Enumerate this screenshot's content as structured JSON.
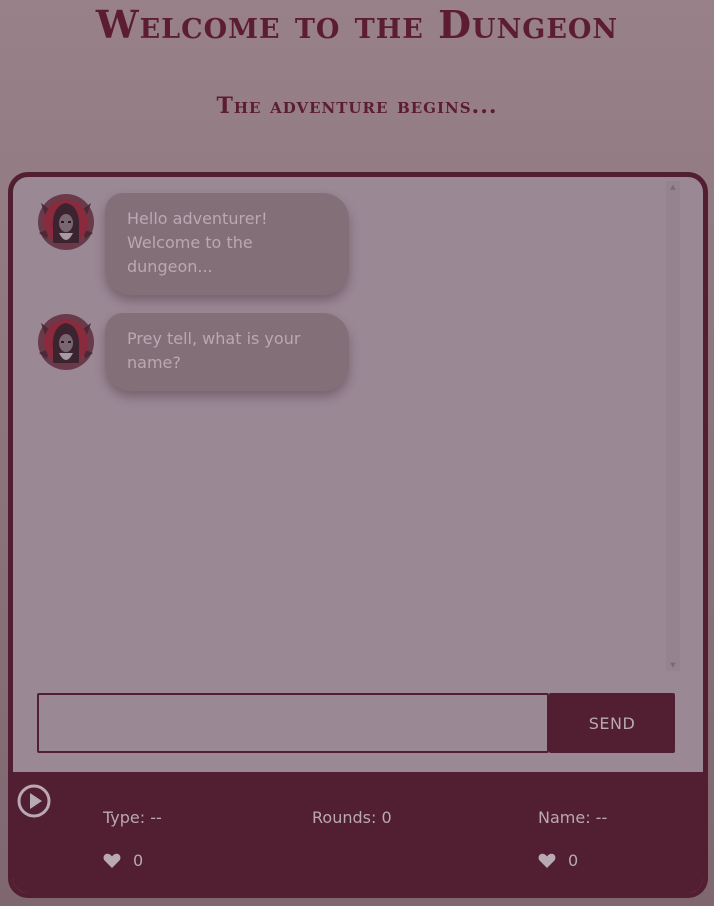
{
  "header": {
    "title": "Welcome to the Dungeon",
    "subtitle": "The adventure begins..."
  },
  "chat": {
    "messages": [
      {
        "sender": "dungeon-master",
        "avatar_icon": "hooded-figure-avatar",
        "text": "Hello adventurer! Welcome to the dungeon..."
      },
      {
        "sender": "dungeon-master",
        "avatar_icon": "hooded-figure-avatar",
        "text": "Prey tell, what is your name?"
      }
    ]
  },
  "composer": {
    "input_value": "",
    "placeholder": "",
    "send_label": "SEND"
  },
  "status": {
    "play_icon": "play-circle-icon",
    "type_text": "Type: --",
    "rounds_text": "Rounds: 0",
    "name_text": "Name: --",
    "left_likes": "0",
    "right_likes": "0",
    "like_icon": "heart-icon"
  },
  "colors": {
    "background": "#8c747c",
    "accent": "#521e31",
    "panel": "#9a8895",
    "bubble": "#836f78",
    "text_light": "#b9a9b3"
  }
}
